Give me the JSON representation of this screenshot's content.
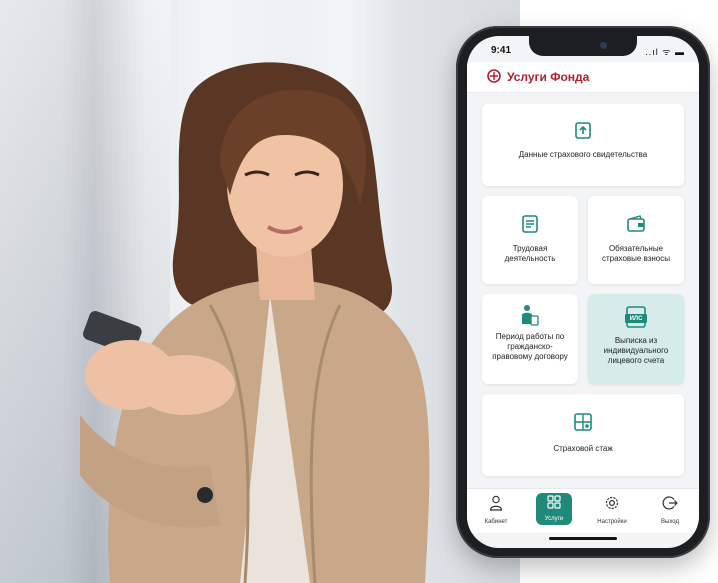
{
  "status": {
    "time": "9:41",
    "icons": "..ıl ᯤ ▬"
  },
  "app": {
    "title": "Услуги Фонда",
    "logo_icon": "fund-logo-icon",
    "brand_color": "#b0202c",
    "accent_color": "#1f8a7a"
  },
  "cards": [
    {
      "label": "Данные страхового свидетельства",
      "icon": "document-upload-icon",
      "selected": false
    },
    {
      "label": "Трудовая деятельность",
      "icon": "document-list-icon",
      "selected": false
    },
    {
      "label": "Обязательные страховые взносы",
      "icon": "wallet-icon",
      "selected": false
    },
    {
      "label": "Период работы по гражданско-правовому договору",
      "icon": "person-document-icon",
      "selected": false
    },
    {
      "label": "Выписка из индивидуального лицевого счета",
      "icon_text": "ИЛС",
      "icon": "ils-document-icon",
      "selected": true
    },
    {
      "label": "Страховой стаж",
      "icon": "grid-calc-icon",
      "selected": false
    }
  ],
  "tabs": [
    {
      "label": "Кабинет",
      "icon": "person-icon",
      "active": false
    },
    {
      "label": "Услуги",
      "icon": "services-grid-icon",
      "active": true
    },
    {
      "label": "Настройки",
      "icon": "gear-icon",
      "active": false
    },
    {
      "label": "Выход",
      "icon": "logout-icon",
      "active": false
    }
  ]
}
